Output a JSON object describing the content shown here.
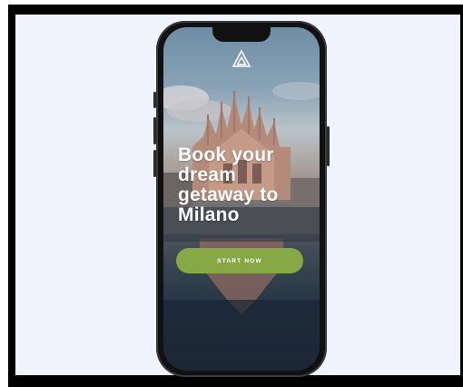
{
  "app": {
    "logo_icon": "triangle-logo-icon",
    "headline": "Book your dream getaway to Milano",
    "cta_label": "START NOW"
  },
  "colors": {
    "accent": "#86a845",
    "background": "#eff4ff",
    "frame": "#000000"
  }
}
